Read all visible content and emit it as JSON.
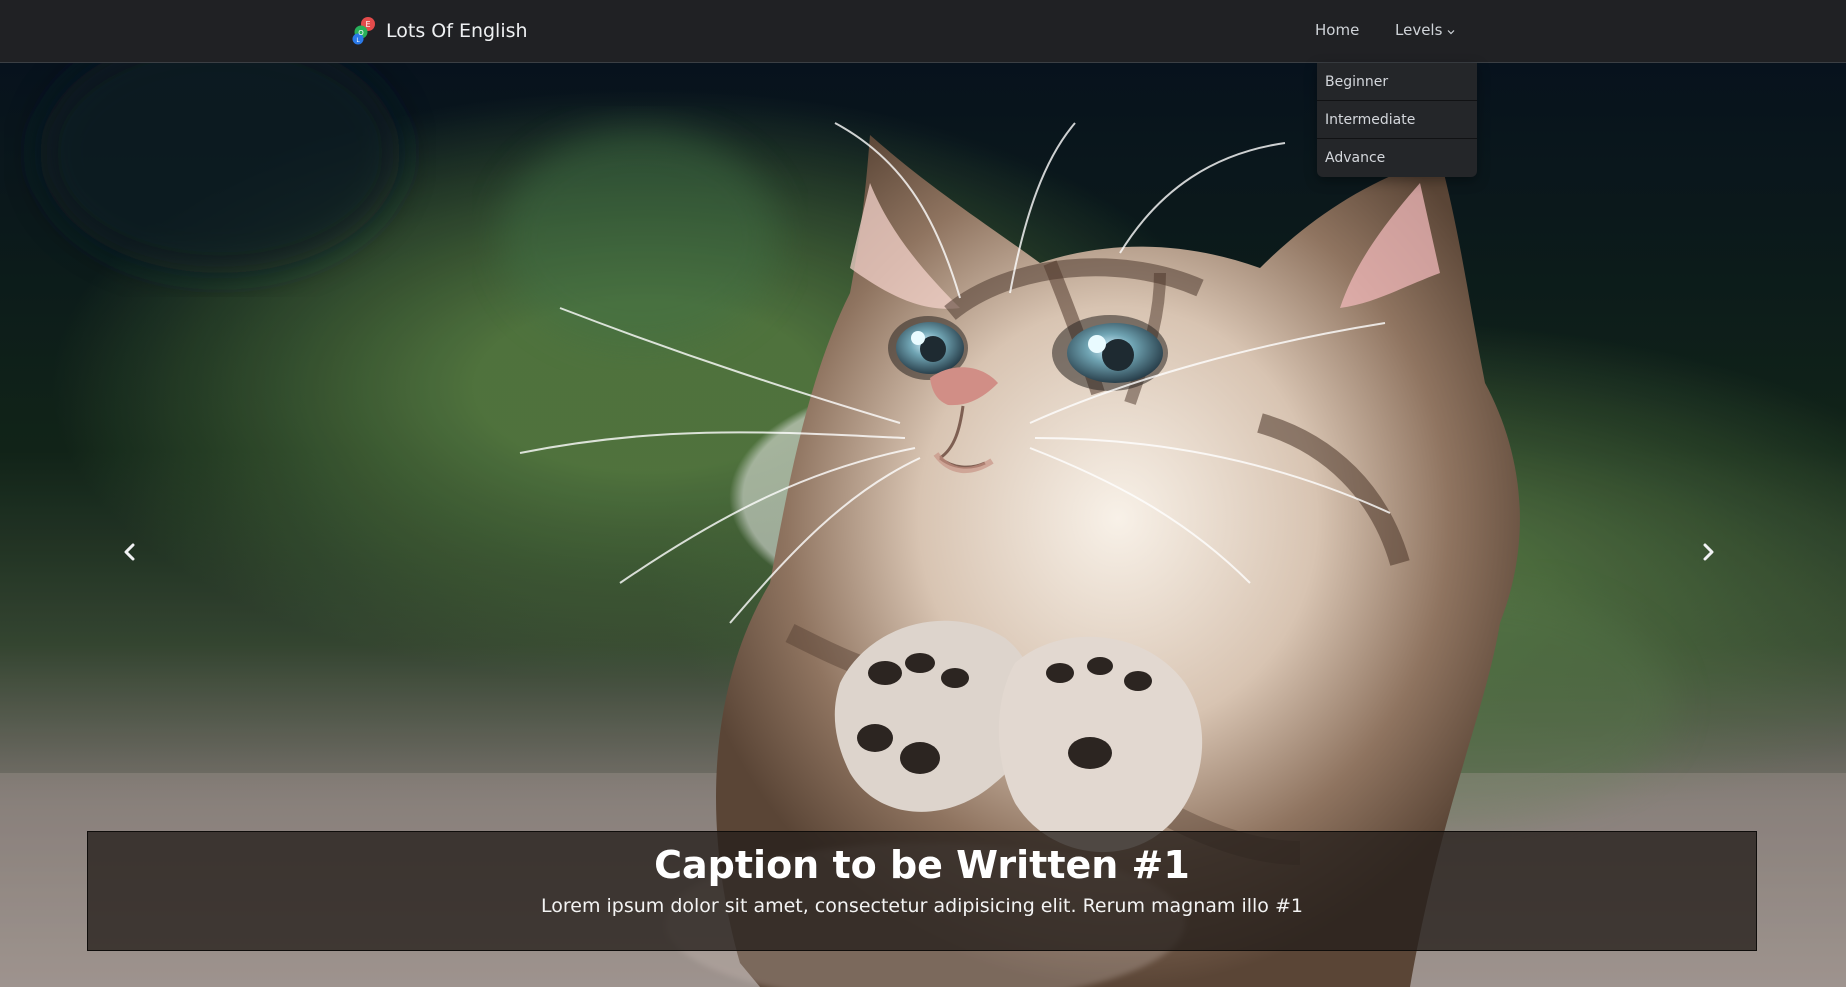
{
  "navbar": {
    "brand": "Lots Of English",
    "logo_icon": "ole-logo",
    "home": "Home",
    "levels": "Levels",
    "levels_icon": "chevron-down-icon"
  },
  "dropdown": {
    "items": [
      "Beginner",
      "Intermediate",
      "Advance"
    ]
  },
  "hero": {
    "previous_icon": "chevron-left-icon",
    "next_icon": "chevron-right-icon",
    "caption_title": "Caption to be Written #1",
    "caption_text": "Lorem ipsum dolor sit amet, consectetur adipisicing elit. Rerum magnam illo #1"
  },
  "colors": {
    "navbar": "#202124",
    "dropdown": "#242629",
    "caption_background": "#251f1b"
  }
}
